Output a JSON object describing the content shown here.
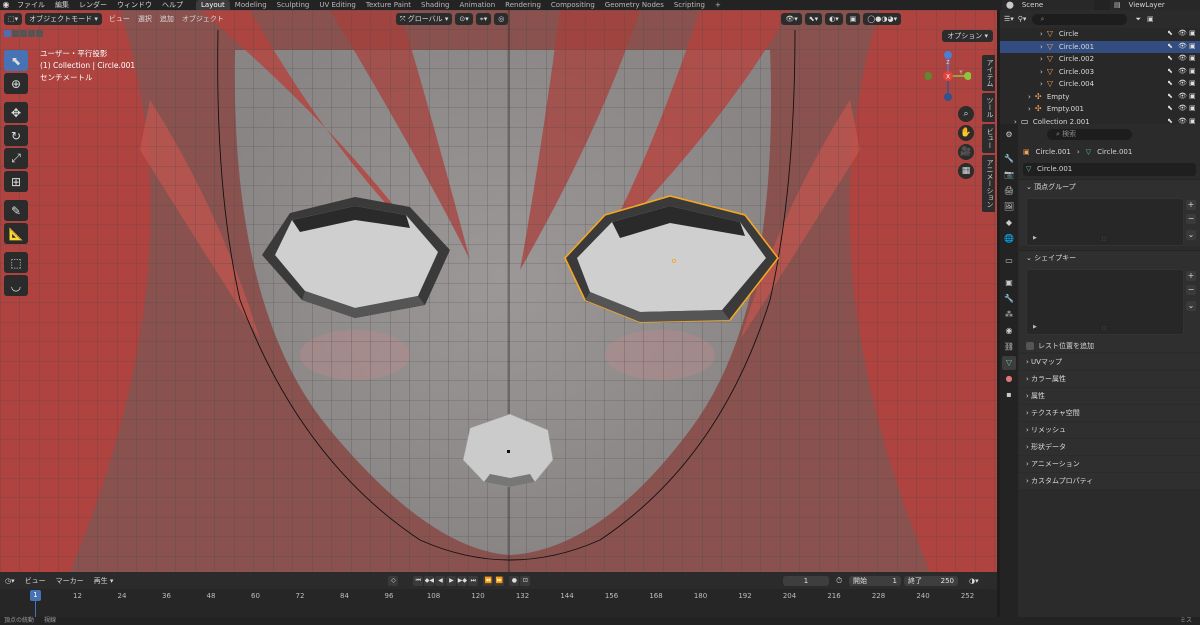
{
  "topbar": {
    "menus": [
      "ファイル",
      "編集",
      "レンダー",
      "ウィンドウ",
      "ヘルプ"
    ],
    "workspaces": [
      {
        "label": "Layout",
        "active": true
      },
      {
        "label": "Modeling"
      },
      {
        "label": "Sculpting"
      },
      {
        "label": "UV Editing"
      },
      {
        "label": "Texture Paint"
      },
      {
        "label": "Shading"
      },
      {
        "label": "Animation"
      },
      {
        "label": "Rendering"
      },
      {
        "label": "Compositing"
      },
      {
        "label": "Geometry Nodes"
      },
      {
        "label": "Scripting"
      }
    ],
    "add_tab": "+",
    "scene": "Scene",
    "view_layer": "ViewLayer"
  },
  "viewport_header": {
    "mode": "オブジェクトモード",
    "menus": [
      "ビュー",
      "選択",
      "追加",
      "オブジェクト"
    ],
    "transform": "グローバル"
  },
  "viewport": {
    "options": "オプション",
    "info_line1": "ユーザー・平行投影",
    "info_line2": "(1) Collection | Circle.001",
    "info_line3": "センチメートル",
    "gizmo": {
      "x": "X",
      "y": "Y",
      "z": "Z"
    },
    "n_tabs": [
      "アイテム",
      "ツール",
      "ビュー",
      "アニメーション"
    ]
  },
  "timeline": {
    "menus": [
      "ビュー",
      "マーカー",
      "再生"
    ],
    "current_frame": "1",
    "start_label": "開始",
    "start": "1",
    "end_label": "終了",
    "end": "250",
    "ticks": [
      "12",
      "24",
      "36",
      "48",
      "60",
      "72",
      "84",
      "96",
      "108",
      "120",
      "132",
      "144",
      "156",
      "168",
      "180",
      "192",
      "204",
      "216",
      "228",
      "240",
      "252"
    ],
    "playhead": "1"
  },
  "statusbar": {
    "left": "頂点の統動",
    "left2": "視線",
    "right": "ミス"
  },
  "outliner": {
    "rows": [
      {
        "label": "Circle",
        "indent": 40,
        "selected": false
      },
      {
        "label": "Circle.001",
        "indent": 40,
        "selected": true
      },
      {
        "label": "Circle.002",
        "indent": 40,
        "selected": false
      },
      {
        "label": "Circle.003",
        "indent": 40,
        "selected": false
      },
      {
        "label": "Circle.004",
        "indent": 40,
        "selected": false
      },
      {
        "label": "Empty",
        "indent": 28,
        "selected": false
      },
      {
        "label": "Empty.001",
        "indent": 28,
        "selected": false
      },
      {
        "label": "Collection 2.001",
        "indent": 14,
        "selected": false
      }
    ]
  },
  "properties": {
    "search_placeholder": "検索",
    "breadcrumb_object": "Circle.001",
    "breadcrumb_mesh": "Circle.001",
    "datablock": "Circle.001",
    "vertex_groups": "頂点グループ",
    "shape_keys": "シェイプキー",
    "rest_position": "レスト位置を追加",
    "collapsed_panels": [
      "UVマップ",
      "カラー属性",
      "属性",
      "テクスチャ空間",
      "リメッシュ",
      "形状データ",
      "アニメーション",
      "カスタムプロパティ"
    ]
  },
  "colors": {
    "accent": "#4772b3",
    "selection": "#f5a623",
    "hair": "#b5413c"
  }
}
